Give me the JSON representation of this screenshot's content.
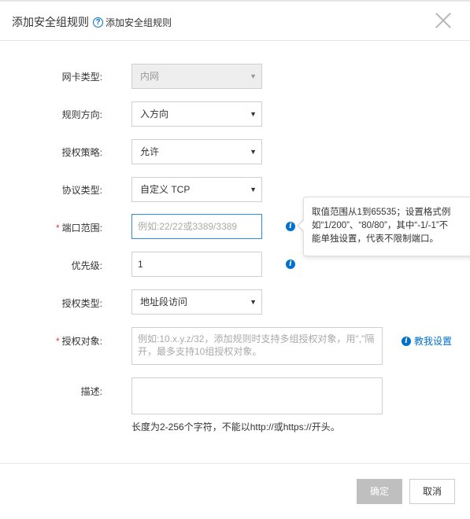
{
  "dialog": {
    "title": "添加安全组规则",
    "help_link": "添加安全组规则"
  },
  "fields": {
    "nic_type": {
      "label": "网卡类型:",
      "value": "内网"
    },
    "direction": {
      "label": "规则方向:",
      "value": "入方向"
    },
    "policy": {
      "label": "授权策略:",
      "value": "允许"
    },
    "protocol": {
      "label": "协议类型:",
      "value": "自定义 TCP"
    },
    "port_range": {
      "label": "端口范围:",
      "placeholder": "例如:22/22或3389/3389"
    },
    "priority": {
      "label": "优先级:",
      "value": "1"
    },
    "auth_type": {
      "label": "授权类型:",
      "value": "地址段访问"
    },
    "auth_object": {
      "label": "授权对象:",
      "placeholder": "例如:10.x.y.z/32，添加规则时支持多组授权对象，用\",\"隔开，最多支持10组授权对象。",
      "link": "教我设置"
    },
    "description": {
      "label": "描述:",
      "hint": "长度为2-256个字符，不能以http://或https://开头。"
    }
  },
  "tooltip": {
    "line1": "取值范围从1到65535；设置格式例",
    "line2": "如“1/200”、“80/80”，其中“-1/-1”不",
    "line3": "能单独设置，代表不限制端口。"
  },
  "buttons": {
    "ok": "确定",
    "cancel": "取消"
  },
  "colors": {
    "accent": "#0070cc",
    "required": "#e4393c",
    "focus_border": "#2b8ee8",
    "disabled_button": "#bfbfbf"
  }
}
